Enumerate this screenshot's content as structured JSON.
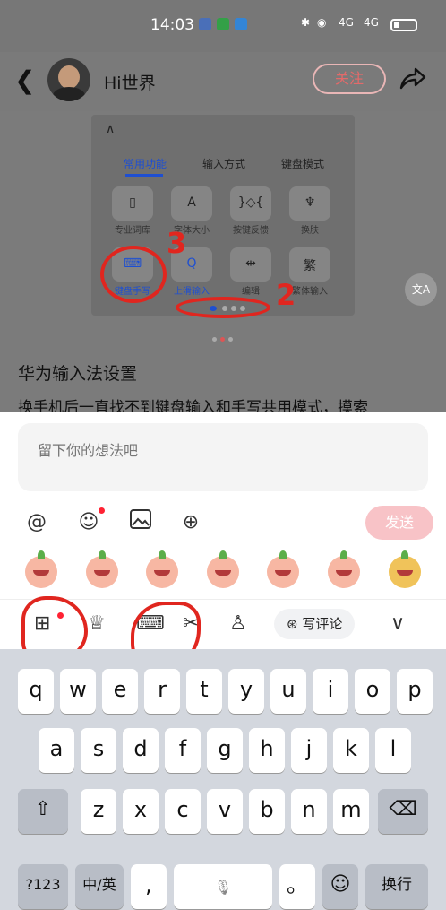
{
  "status_bar": {
    "time": "14:03",
    "signal": "4G"
  },
  "header": {
    "back_icon": "chevron-left-icon",
    "username": "Hi世界",
    "follow_label": "关注",
    "share_icon": "share-icon"
  },
  "post_image": {
    "tabs": [
      "常用功能",
      "输入方式",
      "键盘模式"
    ],
    "items": [
      {
        "icon": "▯",
        "label": "专业词库"
      },
      {
        "icon": "A",
        "label": "字体大小"
      },
      {
        "icon": "}◇{",
        "label": "按键反馈"
      },
      {
        "icon": "♆",
        "label": "换肤"
      },
      {
        "icon": "⌨",
        "label": "键盘手写"
      },
      {
        "icon": "Q",
        "label": "上滑输入"
      },
      {
        "icon": "⇹",
        "label": "编辑"
      },
      {
        "icon": "繁",
        "label": "繁体输入"
      }
    ],
    "annotation_3": "3",
    "annotation_2": "2"
  },
  "translate_icon": "文A",
  "post": {
    "title": "华为输入法设置",
    "body": "换手机后一直找不到键盘输入和手写共用模式，摸索"
  },
  "comment": {
    "placeholder": "留下你的想法吧",
    "send_label": "发送"
  },
  "ime_toolbar": {
    "write_review": "写评论"
  },
  "keyboard": {
    "row1": [
      "q",
      "w",
      "e",
      "r",
      "t",
      "y",
      "u",
      "i",
      "o",
      "p"
    ],
    "row2": [
      "a",
      "s",
      "d",
      "f",
      "g",
      "h",
      "j",
      "k",
      "l"
    ],
    "row3": [
      "z",
      "x",
      "c",
      "v",
      "b",
      "n",
      "m"
    ],
    "shift": "⇧",
    "backspace": "⌫",
    "num_label": "?123",
    "lang_label": "中/英",
    "comma": ",",
    "period": "。",
    "emoji": "☺",
    "enter_label": "换行"
  }
}
